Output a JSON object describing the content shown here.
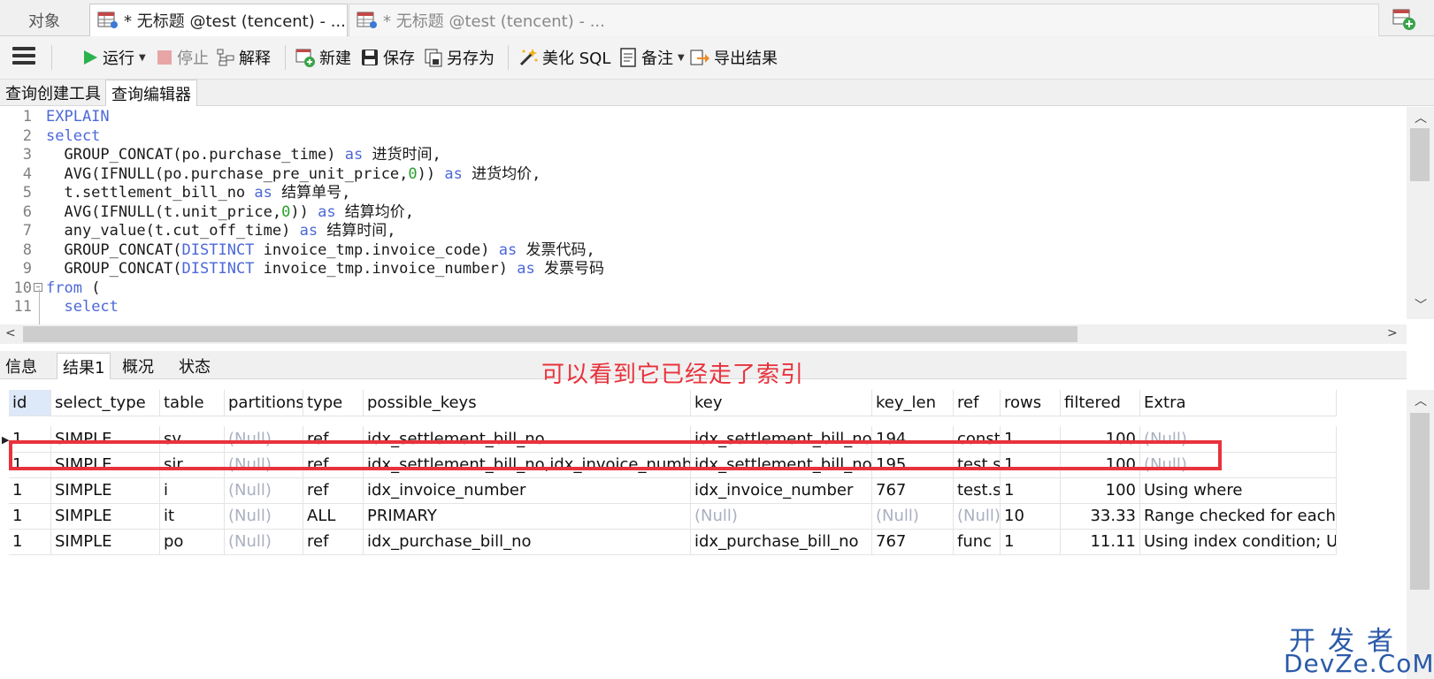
{
  "tabs": {
    "objects": "对象",
    "query1": "* 无标题 @test (tencent) - ...",
    "query2": "* 无标题 @test (tencent) - ..."
  },
  "toolbar": {
    "run": "运行",
    "stop": "停止",
    "explain": "解释",
    "new": "新建",
    "save": "保存",
    "save_as": "另存为",
    "beautify": "美化 SQL",
    "note": "备注",
    "export": "导出结果"
  },
  "subtabs": [
    "查询创建工具",
    "查询编辑器"
  ],
  "editor": {
    "lines": [
      {
        "n": "1",
        "parts": [
          [
            "kw",
            "EXPLAIN"
          ]
        ]
      },
      {
        "n": "2",
        "parts": [
          [
            "kw",
            "select"
          ]
        ]
      },
      {
        "n": "3",
        "parts": [
          [
            "t",
            "  GROUP_CONCAT(po.purchase_time) "
          ],
          [
            "kw",
            "as"
          ],
          [
            "t",
            " 进货时间,"
          ]
        ]
      },
      {
        "n": "4",
        "parts": [
          [
            "t",
            "  AVG(IFNULL(po.purchase_pre_unit_price,"
          ],
          [
            "num",
            "0"
          ],
          [
            "t",
            ")) "
          ],
          [
            "kw",
            "as"
          ],
          [
            "t",
            " 进货均价,"
          ]
        ]
      },
      {
        "n": "5",
        "parts": [
          [
            "t",
            "  t.settlement_bill_no "
          ],
          [
            "kw",
            "as"
          ],
          [
            "t",
            " 结算单号,"
          ]
        ]
      },
      {
        "n": "6",
        "parts": [
          [
            "t",
            "  AVG(IFNULL(t.unit_price,"
          ],
          [
            "num",
            "0"
          ],
          [
            "t",
            ")) "
          ],
          [
            "kw",
            "as"
          ],
          [
            "t",
            " 结算均价,"
          ]
        ]
      },
      {
        "n": "7",
        "parts": [
          [
            "t",
            "  any_value(t.cut_off_time) "
          ],
          [
            "kw",
            "as"
          ],
          [
            "t",
            " 结算时间,"
          ]
        ]
      },
      {
        "n": "8",
        "parts": [
          [
            "t",
            "  GROUP_CONCAT("
          ],
          [
            "kw",
            "DISTINCT"
          ],
          [
            "t",
            " invoice_tmp.invoice_code) "
          ],
          [
            "kw",
            "as"
          ],
          [
            "t",
            " 发票代码,"
          ]
        ]
      },
      {
        "n": "9",
        "parts": [
          [
            "t",
            "  GROUP_CONCAT("
          ],
          [
            "kw",
            "DISTINCT"
          ],
          [
            "t",
            " invoice_tmp.invoice_number) "
          ],
          [
            "kw",
            "as"
          ],
          [
            "t",
            " 发票号码"
          ]
        ]
      },
      {
        "n": "10",
        "parts": [
          [
            "kw",
            "from"
          ],
          [
            "t",
            " ("
          ]
        ]
      },
      {
        "n": "11",
        "parts": [
          [
            "t",
            "  "
          ],
          [
            "kw",
            "select"
          ]
        ]
      }
    ]
  },
  "result_tabs": [
    "信息",
    "结果1",
    "概况",
    "状态"
  ],
  "annotation": "可以看到它已经走了索引",
  "grid": {
    "columns": [
      "id",
      "select_type",
      "table",
      "partitions",
      "type",
      "possible_keys",
      "key",
      "key_len",
      "ref",
      "rows",
      "filtered",
      "Extra"
    ],
    "rows": [
      [
        "1",
        "SIMPLE",
        "sv",
        "(Null)",
        "ref",
        "idx_settlement_bill_no",
        "idx_settlement_bill_no",
        "194",
        "const",
        "1",
        "100",
        "(Null)"
      ],
      [
        "1",
        "SIMPLE",
        "sir",
        "(Null)",
        "ref",
        "idx_settlement_bill_no,idx_invoice_number",
        "idx_settlement_bill_no",
        "195",
        "test.sv",
        "1",
        "100",
        "(Null)"
      ],
      [
        "1",
        "SIMPLE",
        "i",
        "(Null)",
        "ref",
        "idx_invoice_number",
        "idx_invoice_number",
        "767",
        "test.si",
        "1",
        "100",
        "Using where"
      ],
      [
        "1",
        "SIMPLE",
        "it",
        "(Null)",
        "ALL",
        "PRIMARY",
        "(Null)",
        "(Null)",
        "(Null)",
        "10",
        "33.33",
        "Range checked for each re"
      ],
      [
        "1",
        "SIMPLE",
        "po",
        "(Null)",
        "ref",
        "idx_purchase_bill_no",
        "idx_purchase_bill_no",
        "767",
        "func",
        "1",
        "11.11",
        "Using index condition; Usi"
      ]
    ]
  },
  "watermark": {
    "line1": "开发者",
    "line2": "DevZe.CoM"
  },
  "colors": {
    "keyword": "#4c68d8",
    "annotation": "#e8323c",
    "null": "#aab0c0"
  }
}
